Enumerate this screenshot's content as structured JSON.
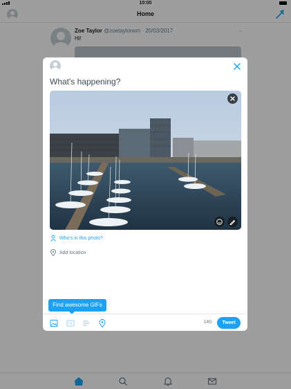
{
  "status_bar": {
    "time": "10:00"
  },
  "nav": {
    "title": "Home"
  },
  "timeline": {
    "tweet": {
      "name": "Zoe Taylor",
      "meta": "@zoetaylorwm · 20/03/2017",
      "text": "Hi!"
    }
  },
  "compose": {
    "placeholder": "What's happening?",
    "tag_people": "Who's in this photo?",
    "add_location": "Add location",
    "tooltip": "Find awesome GIFs",
    "char_count": "140",
    "tweet_button": "Tweet"
  },
  "tabbar": {
    "items": [
      "home-icon",
      "search-icon",
      "notifications-icon",
      "messages-icon"
    ]
  },
  "colors": {
    "accent": "#1da1f2",
    "text": "#14171a",
    "secondary": "#657786",
    "divider": "#e1e8ed"
  }
}
